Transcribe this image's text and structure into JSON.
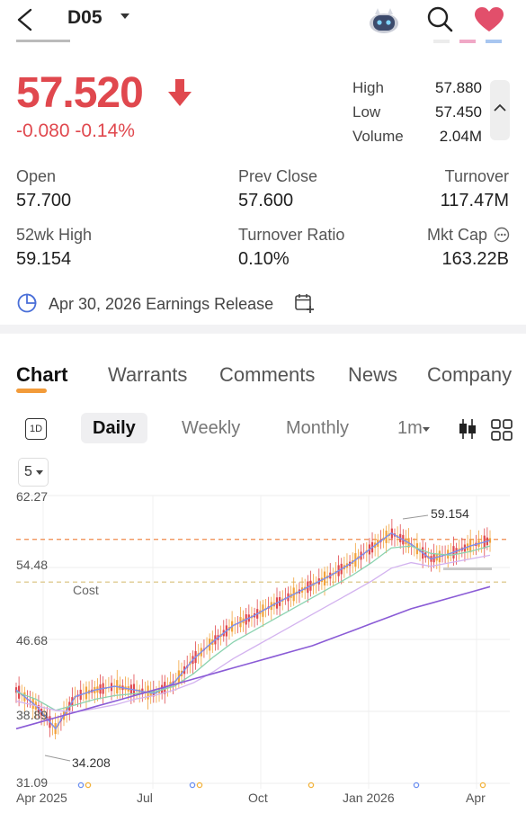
{
  "header": {
    "symbol": "D05"
  },
  "quote": {
    "price": "57.520",
    "change": "-0.080",
    "change_pct": "-0.14%",
    "high_label": "High",
    "high": "57.880",
    "low_label": "Low",
    "low": "57.450",
    "volume_label": "Volume",
    "volume": "2.04M"
  },
  "stats": [
    {
      "label": "Open",
      "value": "57.700"
    },
    {
      "label": "Prev Close",
      "value": "57.600"
    },
    {
      "label": "Turnover",
      "value": "117.47M"
    },
    {
      "label": "52wk High",
      "value": "59.154"
    },
    {
      "label": "Turnover Ratio",
      "value": "0.10%"
    },
    {
      "label": "Mkt Cap",
      "value": "163.22B"
    }
  ],
  "earnings": {
    "text": "Apr 30, 2026 Earnings Release"
  },
  "tabs": [
    "Chart",
    "Warrants",
    "Comments",
    "News",
    "Company"
  ],
  "chart_toolbar": {
    "intraday": "1D",
    "periods": [
      "Daily",
      "Weekly",
      "Monthly"
    ],
    "more": "1m",
    "ma_select": "5"
  },
  "colors": {
    "down": "#e0484e",
    "accent": "#f29b3a",
    "candle_up": "#f2a23a",
    "candle_down": "#e0484e"
  },
  "chart_data": {
    "type": "line",
    "y_ticks": [
      "62.27",
      "54.48",
      "46.68",
      "38.89",
      "31.09"
    ],
    "ylim": [
      31.09,
      62.27
    ],
    "x_ticks": [
      "Apr 2025",
      "Jul",
      "Oct",
      "Jan 2026",
      "Apr"
    ],
    "annotations": {
      "high_label": "59.154",
      "low_label": "34.208",
      "cost_label": "Cost"
    },
    "reference_lines": {
      "last_price": 57.52,
      "cost": 52.9
    },
    "series": [
      {
        "values": [
          41.2,
          39.5,
          37.0,
          40.5,
          41.2,
          41.6,
          41.2,
          40.8,
          42.0,
          44.6,
          46.5,
          48.2,
          49.2,
          50.4,
          51.5,
          52.6,
          53.7,
          55.0,
          56.6,
          58.2,
          57.0,
          55.4,
          56.0,
          56.8,
          57.4
        ]
      },
      {
        "values": [
          41.0,
          40.2,
          39.0,
          39.6,
          40.2,
          40.6,
          40.8,
          41.0,
          41.6,
          43.0,
          44.8,
          46.4,
          47.6,
          48.8,
          50.0,
          51.2,
          52.4,
          53.6,
          55.0,
          56.6,
          56.8,
          56.0,
          55.8,
          56.2,
          56.8
        ]
      },
      {
        "values": [
          40.0,
          39.5,
          39.0,
          38.8,
          39.2,
          39.6,
          40.2,
          40.6,
          41.2,
          42.0,
          43.2,
          44.6,
          45.8,
          47.0,
          48.2,
          49.4,
          50.6,
          51.8,
          53.0,
          54.4,
          55.0,
          54.6,
          55.0,
          55.4,
          55.8
        ]
      },
      {
        "values": [
          37.0,
          37.6,
          38.2,
          38.8,
          39.4,
          40.0,
          40.6,
          41.2,
          41.8,
          42.4,
          43.0,
          43.6,
          44.2,
          44.8,
          45.4,
          46.0,
          46.8,
          47.6,
          48.4,
          49.2,
          50.0,
          50.6,
          51.2,
          51.8,
          52.4
        ]
      }
    ]
  }
}
